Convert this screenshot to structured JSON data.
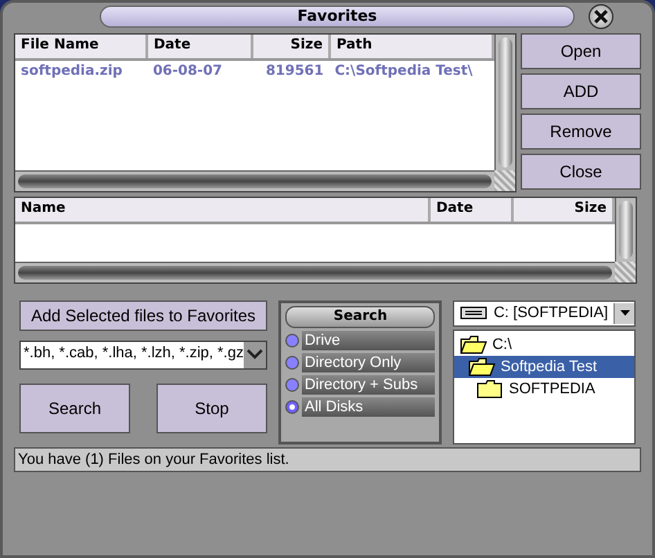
{
  "window": {
    "title": "Favorites"
  },
  "favorites": {
    "columns": [
      "File Name",
      "Date",
      "Size",
      "Path"
    ],
    "rows": [
      {
        "cells": [
          "softpedia.zip",
          "06-08-07",
          "819561",
          "C:\\Softpedia Test\\"
        ]
      }
    ]
  },
  "side_buttons": [
    {
      "label": "Open"
    },
    {
      "label": "ADD"
    },
    {
      "label": "Remove"
    },
    {
      "label": "Close"
    }
  ],
  "results": {
    "columns": [
      "Name",
      "Date",
      "Size"
    ]
  },
  "add_button": {
    "label": "Add Selected files to Favorites"
  },
  "filter": {
    "value": "*.bh, *.cab, *.lha, *.lzh, *.zip, *.gz"
  },
  "search_button": {
    "label": "Search"
  },
  "stop_button": {
    "label": "Stop"
  },
  "search_panel": {
    "title": "Search",
    "options": [
      {
        "label": "Drive",
        "selected": false
      },
      {
        "label": "Directory Only",
        "selected": false
      },
      {
        "label": "Directory + Subs",
        "selected": false
      },
      {
        "label": "All Disks",
        "selected": true
      }
    ]
  },
  "drive": {
    "value": "C: [SOFTPEDIA]"
  },
  "tree": [
    {
      "label": "C:\\",
      "expanded": true,
      "selected": false,
      "children": [
        {
          "label": "Softpedia Test",
          "expanded": true,
          "selected": true,
          "children": [
            {
              "label": "SOFTPEDIA",
              "expanded": false,
              "selected": false
            }
          ]
        }
      ]
    }
  ],
  "status_bar": "You have (1) Files on your Favorites list."
}
